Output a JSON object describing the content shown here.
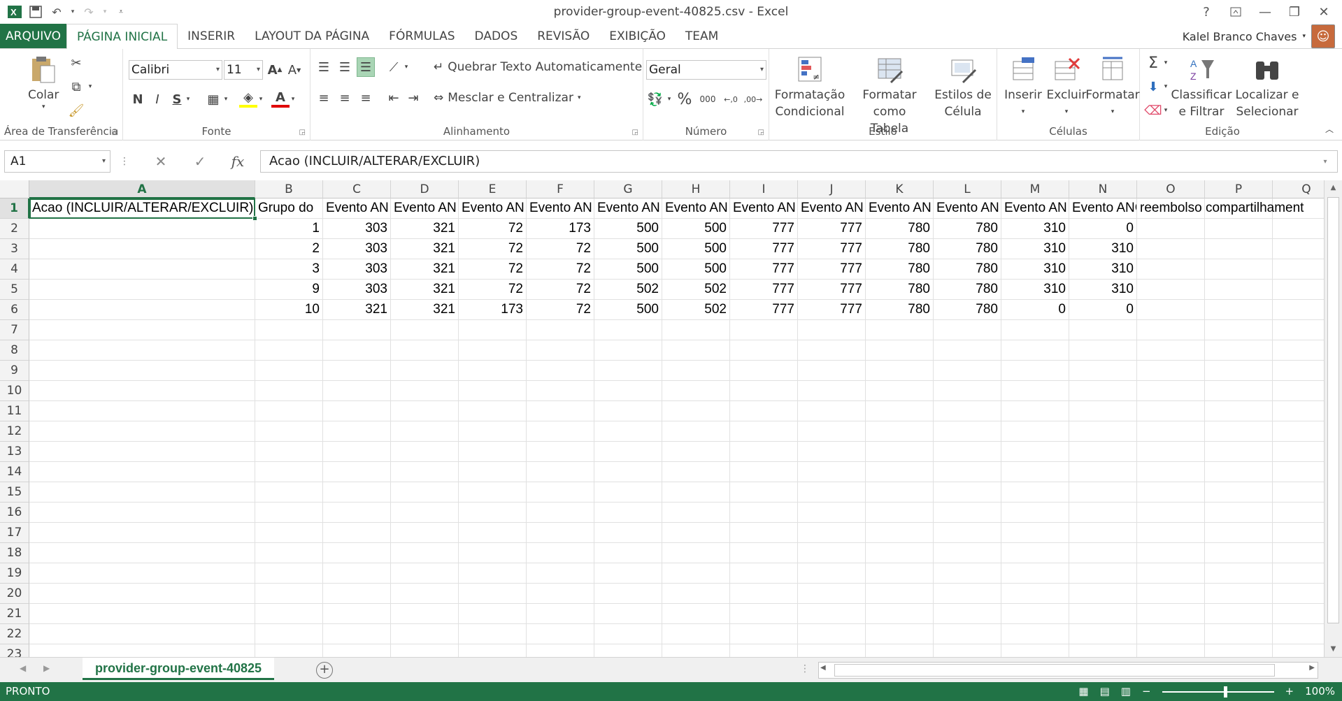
{
  "window": {
    "title": "provider-group-event-40825.csv - Excel",
    "help": "?"
  },
  "tabs": [
    "ARQUIVO",
    "PÁGINA INICIAL",
    "INSERIR",
    "LAYOUT DA PÁGINA",
    "FÓRMULAS",
    "DADOS",
    "REVISÃO",
    "EXIBIÇÃO",
    "TEAM"
  ],
  "account": {
    "name": "Kalel Branco Chaves"
  },
  "ribbon": {
    "clipboard": {
      "label": "Área de Transferência",
      "paste": "Colar"
    },
    "font": {
      "label": "Fonte",
      "family": "Calibri",
      "size": "11",
      "bold": "N",
      "italic": "I",
      "underline": "S"
    },
    "alignment": {
      "label": "Alinhamento",
      "wrap": "Quebrar Texto Automaticamente",
      "merge": "Mesclar e Centralizar"
    },
    "number": {
      "label": "Número",
      "format": "Geral",
      "percent": "%",
      "thousands": "000"
    },
    "styles": {
      "label": "Estilo",
      "cond1": "Formatação",
      "cond2": "Condicional",
      "table1": "Formatar como",
      "table2": "Tabela",
      "cell1": "Estilos de",
      "cell2": "Célula"
    },
    "cells": {
      "label": "Células",
      "insert": "Inserir",
      "delete": "Excluir",
      "format": "Formatar"
    },
    "editing": {
      "label": "Edição",
      "sort1": "Classificar",
      "sort2": "e Filtrar",
      "find1": "Localizar e",
      "find2": "Selecionar"
    }
  },
  "formulabar": {
    "namebox": "A1",
    "fx": "fx",
    "content": "Acao (INCLUIR/ALTERAR/EXCLUIR)"
  },
  "sheet": {
    "columns": [
      "A",
      "B",
      "C",
      "D",
      "E",
      "F",
      "G",
      "H",
      "I",
      "J",
      "K",
      "L",
      "M",
      "N",
      "O",
      "P",
      "Q"
    ],
    "row_numbers": [
      "1",
      "2",
      "3",
      "4",
      "5",
      "6",
      "7",
      "8",
      "9",
      "10",
      "11",
      "12",
      "13",
      "14",
      "15",
      "16",
      "17",
      "18",
      "19",
      "20",
      "21",
      "22",
      "23"
    ],
    "header_row": [
      "Acao (INCLUIR/ALTERAR/EXCLUIR)",
      "Grupo do",
      "Evento AN",
      "Evento AN",
      "Evento AN",
      "Evento AN",
      "Evento AN",
      "Evento AN",
      "Evento AN",
      "Evento AN",
      "Evento AN",
      "Evento AN",
      "Evento AN",
      "Evento ANC",
      "reembolso compartilhament"
    ],
    "rows": [
      [
        "",
        "1",
        "303",
        "321",
        "72",
        "173",
        "500",
        "500",
        "777",
        "777",
        "780",
        "780",
        "310",
        "0"
      ],
      [
        "",
        "2",
        "303",
        "321",
        "72",
        "72",
        "500",
        "500",
        "777",
        "777",
        "780",
        "780",
        "310",
        "310"
      ],
      [
        "",
        "3",
        "303",
        "321",
        "72",
        "72",
        "500",
        "500",
        "777",
        "777",
        "780",
        "780",
        "310",
        "310"
      ],
      [
        "",
        "9",
        "303",
        "321",
        "72",
        "72",
        "502",
        "502",
        "777",
        "777",
        "780",
        "780",
        "310",
        "310"
      ],
      [
        "",
        "10",
        "321",
        "321",
        "173",
        "72",
        "500",
        "502",
        "777",
        "777",
        "780",
        "780",
        "0",
        "0"
      ]
    ],
    "tab_name": "provider-group-event-40825"
  },
  "status": {
    "ready": "PRONTO",
    "zoom": "100%"
  },
  "colors": {
    "accent": "#217346"
  }
}
